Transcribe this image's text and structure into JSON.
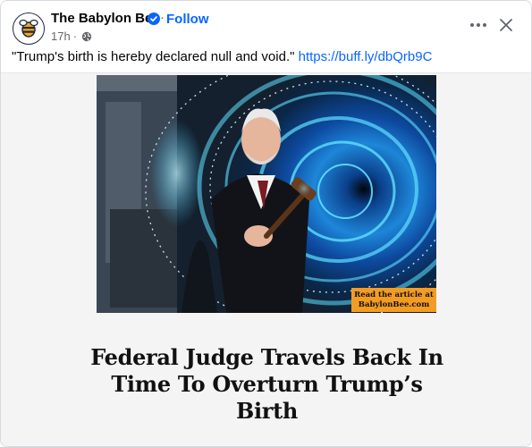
{
  "header": {
    "page_name": "The Babylon Bee",
    "follow_label": "Follow",
    "separator": "·",
    "time_ago": "17h",
    "meta_dot": "·",
    "verified_icon": "verified-badge-icon",
    "privacy_icon": "globe-icon",
    "more_icon": "more-horizontal-icon",
    "close_icon": "close-icon",
    "avatar_icon": "bee-logo-icon"
  },
  "post": {
    "text": "\"Trump's birth is hereby declared null and void.\"",
    "link": "https://buff.ly/dbQrb9C"
  },
  "card": {
    "badge_line1": "Read the article at",
    "badge_line2": "BabylonBee.com",
    "headline": "Federal Judge Travels Back In Time To Overturn Trump’s Birth"
  },
  "colors": {
    "link": "#0866ff",
    "secondary_text": "#65676b",
    "badge": "#f39c23",
    "portal": "#35c8ff"
  }
}
